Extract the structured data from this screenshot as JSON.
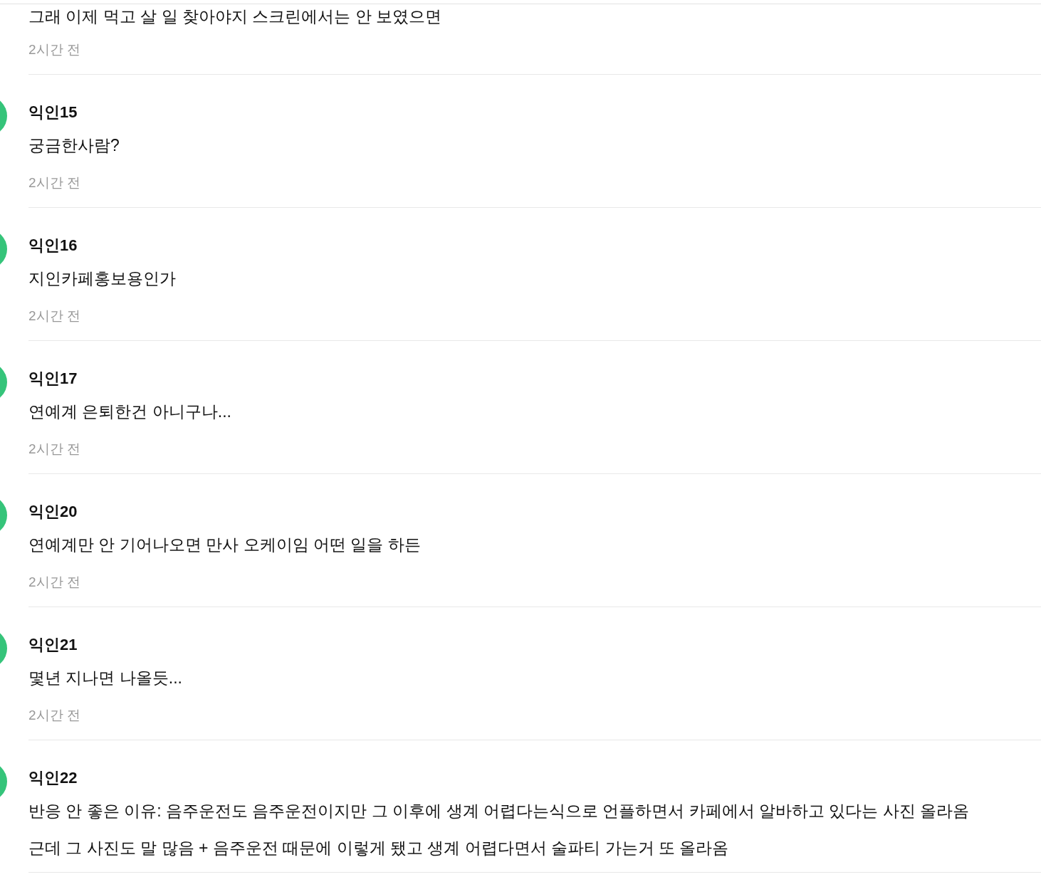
{
  "comments": [
    {
      "lines": [
        "그래 이제 먹고 살 일 찾아야지 스크린에서는 안 보였으면"
      ],
      "time": "2시간 전"
    },
    {
      "author": "익인15",
      "lines": [
        "궁금한사람?"
      ],
      "time": "2시간 전"
    },
    {
      "author": "익인16",
      "lines": [
        "지인카페홍보용인가"
      ],
      "time": "2시간 전"
    },
    {
      "author": "익인17",
      "lines": [
        "연예계 은퇴한건 아니구나..."
      ],
      "time": "2시간 전"
    },
    {
      "author": "익인20",
      "lines": [
        "연예계만 안 기어나오면 만사 오케이임 어떤 일을 하든"
      ],
      "time": "2시간 전"
    },
    {
      "author": "익인21",
      "lines": [
        "몇년 지나면 나올듯..."
      ],
      "time": "2시간 전"
    },
    {
      "author": "익인22",
      "lines": [
        "반응 안 좋은 이유: 음주운전도 음주운전이지만 그 이후에 생계 어렵다는식으로 언플하면서 카페에서 알바하고 있다는 사진 올라옴",
        "근데 그 사진도 말 많음 + 음주운전 때문에 이렇게 됐고 생계 어렵다면서 술파티 가는거 또 올라옴"
      ]
    }
  ]
}
